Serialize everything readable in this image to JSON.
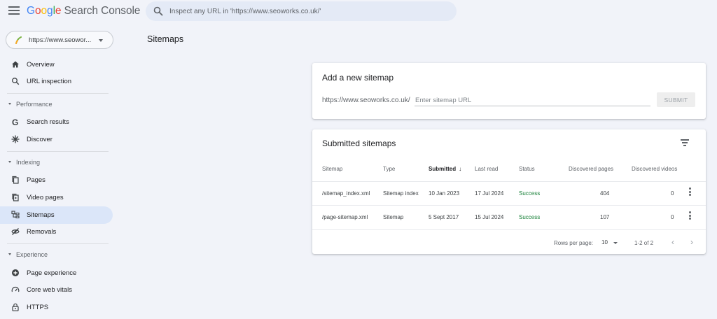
{
  "header": {
    "brand_letters": [
      "G",
      "o",
      "o",
      "g",
      "l",
      "e"
    ],
    "product": "Search Console",
    "search_placeholder": "Inspect any URL in 'https://www.seoworks.co.uk/'"
  },
  "sidebar": {
    "property_label": "https://www.seowor...",
    "top_items": [
      {
        "label": "Overview",
        "icon": "home-icon"
      },
      {
        "label": "URL inspection",
        "icon": "search-icon"
      }
    ],
    "sections": [
      {
        "title": "Performance",
        "items": [
          {
            "label": "Search results",
            "icon": "google-g-icon"
          },
          {
            "label": "Discover",
            "icon": "asterisk-icon"
          }
        ]
      },
      {
        "title": "Indexing",
        "items": [
          {
            "label": "Pages",
            "icon": "pages-icon"
          },
          {
            "label": "Video pages",
            "icon": "video-pages-icon"
          },
          {
            "label": "Sitemaps",
            "icon": "sitemap-icon",
            "active": true
          },
          {
            "label": "Removals",
            "icon": "eye-off-icon"
          }
        ]
      },
      {
        "title": "Experience",
        "items": [
          {
            "label": "Page experience",
            "icon": "plus-circle-icon"
          },
          {
            "label": "Core web vitals",
            "icon": "gauge-icon"
          },
          {
            "label": "HTTPS",
            "icon": "lock-icon"
          }
        ]
      }
    ]
  },
  "page": {
    "title": "Sitemaps"
  },
  "add_sitemap": {
    "title": "Add a new sitemap",
    "url_prefix": "https://www.seoworks.co.uk/",
    "input_placeholder": "Enter sitemap URL",
    "submit_label": "SUBMIT"
  },
  "submitted": {
    "title": "Submitted sitemaps",
    "columns": {
      "sitemap": "Sitemap",
      "type": "Type",
      "submitted": "Submitted",
      "last_read": "Last read",
      "status": "Status",
      "discovered_pages": "Discovered pages",
      "discovered_videos": "Discovered videos"
    },
    "sort_arrow": "↓",
    "rows": [
      {
        "sitemap": "/sitemap_index.xml",
        "type": "Sitemap index",
        "submitted": "10 Jan 2023",
        "last_read": "17 Jul 2024",
        "status": "Success",
        "discovered_pages": "404",
        "discovered_videos": "0"
      },
      {
        "sitemap": "/page-sitemap.xml",
        "type": "Sitemap",
        "submitted": "5 Sept 2017",
        "last_read": "15 Jul 2024",
        "status": "Success",
        "discovered_pages": "107",
        "discovered_videos": "0"
      }
    ],
    "footer": {
      "rows_per_page_label": "Rows per page:",
      "rows_per_page_value": "10",
      "range": "1-2 of 2",
      "prev": "‹",
      "next": "›"
    }
  },
  "colors": {
    "accent": "#1a73e8",
    "active_nav": "#dbe6f9",
    "success": "#188038",
    "background": "#f1f3f9"
  }
}
